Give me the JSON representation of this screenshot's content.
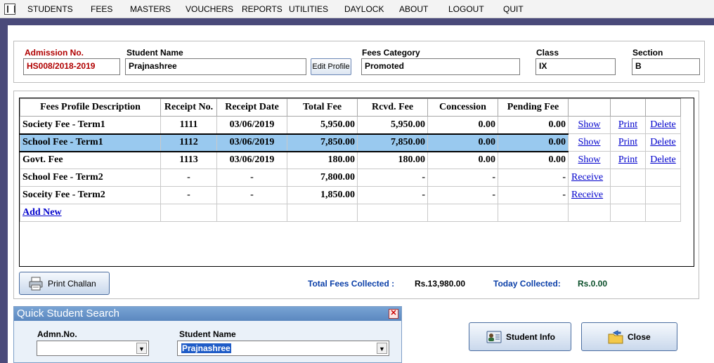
{
  "menu": {
    "items": [
      "STUDENTS",
      "FEES",
      "MASTERS",
      "VOUCHERS",
      "REPORTS",
      "UTILITIES",
      "DAYLOCK",
      "ABOUT",
      "LOGOUT",
      "QUIT"
    ]
  },
  "profile": {
    "admission_label": "Admission No.",
    "admission_value": "HS008/2018-2019",
    "student_name_label": "Student Name",
    "student_name_value": "Prajnashree",
    "edit_profile_label": "Edit Profile",
    "fees_category_label": "Fees Category",
    "fees_category_value": "Promoted",
    "class_label": "Class",
    "class_value": "IX",
    "section_label": "Section",
    "section_value": "B"
  },
  "table": {
    "headers": [
      "Fees Profile Description",
      "Receipt No.",
      "Receipt Date",
      "Total Fee",
      "Rcvd. Fee",
      "Concession",
      "Pending Fee",
      "",
      "",
      ""
    ],
    "rows": [
      {
        "desc": "Society Fee - Term1",
        "receipt": "1111",
        "date": "03/06/2019",
        "total": "5,950.00",
        "rcvd": "5,950.00",
        "concession": "0.00",
        "pending": "0.00",
        "a1": "Show",
        "a2": "Print",
        "a3": "Delete"
      },
      {
        "desc": "School Fee - Term1",
        "receipt": "1112",
        "date": "03/06/2019",
        "total": "7,850.00",
        "rcvd": "7,850.00",
        "concession": "0.00",
        "pending": "0.00",
        "a1": "Show",
        "a2": "Print",
        "a3": "Delete"
      },
      {
        "desc": "Govt. Fee",
        "receipt": "1113",
        "date": "03/06/2019",
        "total": "180.00",
        "rcvd": "180.00",
        "concession": "0.00",
        "pending": "0.00",
        "a1": "Show",
        "a2": "Print",
        "a3": "Delete"
      },
      {
        "desc": "School Fee - Term2",
        "receipt": "-",
        "date": "-",
        "total": "7,800.00",
        "rcvd": "-",
        "concession": "-",
        "pending": "-",
        "a1": "Receive",
        "a2": "",
        "a3": ""
      },
      {
        "desc": "Soceity Fee - Term2",
        "receipt": "-",
        "date": "-",
        "total": "1,850.00",
        "rcvd": "-",
        "concession": "-",
        "pending": "-",
        "a1": "Receive",
        "a2": "",
        "a3": ""
      }
    ],
    "add_new_label": "Add New"
  },
  "footer": {
    "print_challan_label": "Print Challan",
    "total_collected_label": "Total Fees Collected :",
    "total_collected_value": "Rs.13,980.00",
    "today_collected_label": "Today Collected:",
    "today_collected_value": "Rs.0.00"
  },
  "quick_search": {
    "title": "Quick Student Search",
    "admn_label": "Admn.No.",
    "admn_value": "",
    "student_name_label": "Student Name",
    "student_name_value": "Prajnashree"
  },
  "actions": {
    "student_info_label": "Student Info",
    "close_label": "Close"
  },
  "colors": {
    "selected_row": "#99c9ef",
    "link": "#0000cc",
    "label_red": "#b00000"
  }
}
